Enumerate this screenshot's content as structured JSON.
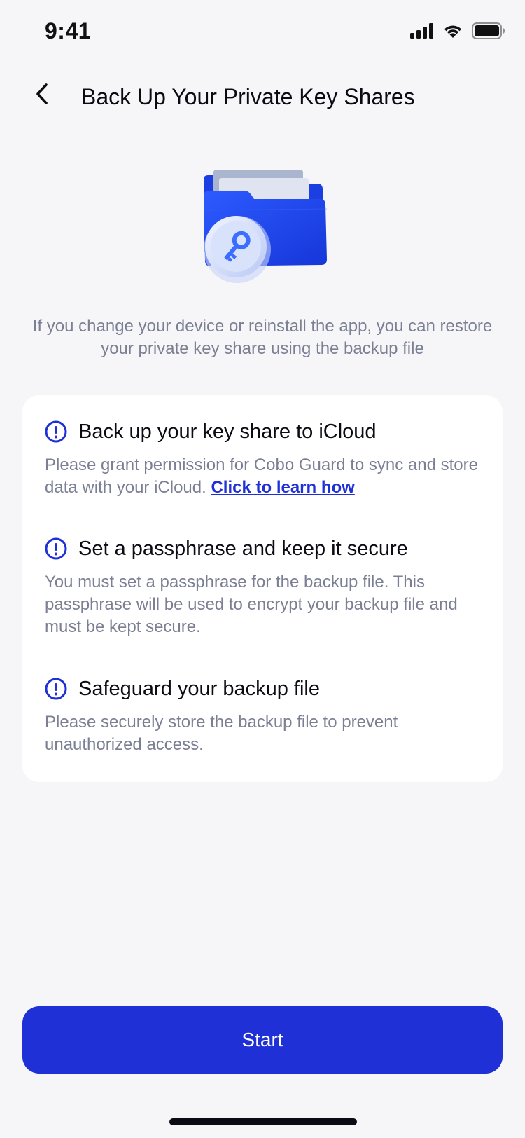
{
  "status_bar": {
    "time": "9:41"
  },
  "nav": {
    "title": "Back Up Your Private Key Shares"
  },
  "intro": "If you change your device or reinstall the app, you can restore your private key share using the backup file",
  "info_items": [
    {
      "title": "Back up your key share to iCloud",
      "description": "Please grant permission for Cobo Guard to sync and store data with your iCloud.",
      "link_label": "Click to learn how"
    },
    {
      "title": "Set a passphrase and keep it secure",
      "description": "You must set a passphrase for the backup file. This passphrase will be used to encrypt your backup file and must be kept secure."
    },
    {
      "title": "Safeguard your backup file",
      "description": "Please securely store the backup file to prevent unauthorized access."
    }
  ],
  "start_button": {
    "label": "Start"
  },
  "icons": {
    "back": "chevron-left-icon",
    "info": "exclamation-circle-icon",
    "illustration": "folder-key-icon",
    "signal": "cellular-signal-icon",
    "wifi": "wifi-icon",
    "battery": "battery-icon"
  },
  "colors": {
    "background": "#f6f6f9",
    "primary": "#1f30d6",
    "text_primary": "#0b0b14",
    "text_secondary": "#7b7f93",
    "card": "#ffffff"
  }
}
